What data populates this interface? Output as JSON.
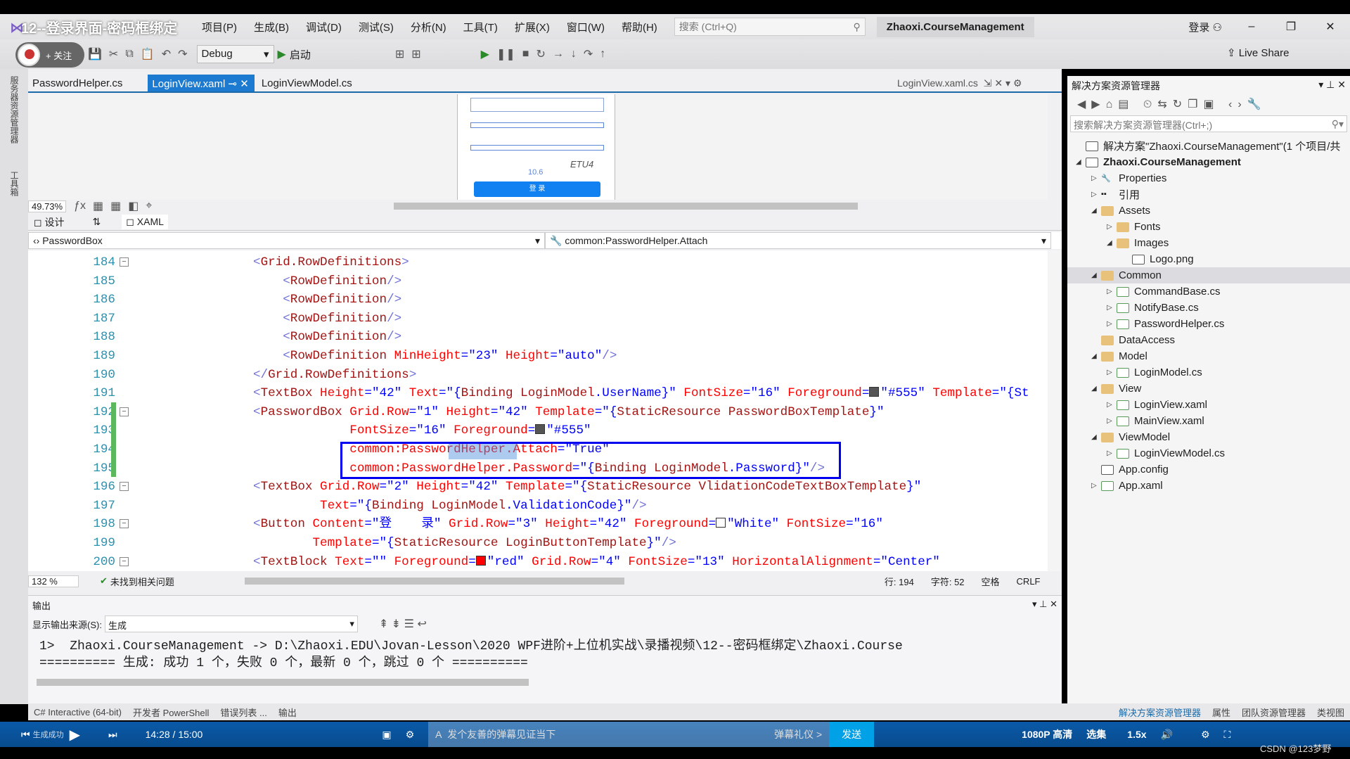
{
  "video_title": "12--登录界面-密码框绑定",
  "menu": [
    "项目(P)",
    "生成(B)",
    "调试(D)",
    "测试(S)",
    "分析(N)",
    "工具(T)",
    "扩展(X)",
    "窗口(W)",
    "帮助(H)"
  ],
  "search_placeholder": "搜索 (Ctrl+Q)",
  "solution_name": "Zhaoxi.CourseManagement",
  "login": "登录",
  "follow": "+ 关注",
  "config": "Debug",
  "start": "启动",
  "live_share": "Live Share",
  "left_strip": [
    "服务器资源管理器",
    "工具箱"
  ],
  "tabs": [
    {
      "label": "PasswordHelper.cs",
      "active": false
    },
    {
      "label": "LoginView.xaml",
      "active": true
    },
    {
      "label": "LoginViewModel.cs",
      "active": false
    }
  ],
  "tab_right": "LoginView.xaml.cs",
  "designer": {
    "zoom": "49.73%",
    "etu": "ETU4",
    "dim": "10.6",
    "button": "登 录",
    "design_tab": "设计",
    "xaml_tab": "XAML"
  },
  "nav": {
    "element": "PasswordBox",
    "member": "common:PasswordHelper.Attach"
  },
  "code_lines": [
    {
      "n": "184",
      "fold": true,
      "segs": [
        [
          "brk",
          "<"
        ],
        [
          "tagc",
          "Grid.RowDefinitions"
        ],
        [
          "brk",
          ">"
        ]
      ]
    },
    {
      "n": "185",
      "segs": [
        [
          "plain",
          "    "
        ],
        [
          "brk",
          "<"
        ],
        [
          "tagc",
          "RowDefinition"
        ],
        [
          "brk",
          "/>"
        ]
      ]
    },
    {
      "n": "186",
      "segs": [
        [
          "plain",
          "    "
        ],
        [
          "brk",
          "<"
        ],
        [
          "tagc",
          "RowDefinition"
        ],
        [
          "brk",
          "/>"
        ]
      ]
    },
    {
      "n": "187",
      "segs": [
        [
          "plain",
          "    "
        ],
        [
          "brk",
          "<"
        ],
        [
          "tagc",
          "RowDefinition"
        ],
        [
          "brk",
          "/>"
        ]
      ]
    },
    {
      "n": "188",
      "segs": [
        [
          "plain",
          "    "
        ],
        [
          "brk",
          "<"
        ],
        [
          "tagc",
          "RowDefinition"
        ],
        [
          "brk",
          "/>"
        ]
      ]
    },
    {
      "n": "189",
      "segs": [
        [
          "plain",
          "    "
        ],
        [
          "brk",
          "<"
        ],
        [
          "tagc",
          "RowDefinition "
        ],
        [
          "attr",
          "MinHeight"
        ],
        [
          "val",
          "=\"23\" "
        ],
        [
          "attr",
          "Height"
        ],
        [
          "val",
          "=\"auto\""
        ],
        [
          "brk",
          "/>"
        ]
      ]
    },
    {
      "n": "190",
      "segs": [
        [
          "brk",
          "</"
        ],
        [
          "tagc",
          "Grid.RowDefinitions"
        ],
        [
          "brk",
          ">"
        ]
      ]
    },
    {
      "n": "191",
      "segs": [
        [
          "brk",
          "<"
        ],
        [
          "tagc",
          "TextBox "
        ],
        [
          "attr",
          "Height"
        ],
        [
          "val",
          "=\"42\" "
        ],
        [
          "attr",
          "Text"
        ],
        [
          "val",
          "=\"{"
        ],
        [
          "tagc",
          "Binding LoginModel"
        ],
        [
          "val",
          ".UserName}\" "
        ],
        [
          "attr",
          "FontSize"
        ],
        [
          "val",
          "=\"16\" "
        ],
        [
          "attr",
          "Foreground"
        ],
        [
          "val",
          "="
        ],
        [
          "swatch",
          "#555555"
        ],
        [
          "val",
          "\"#555\" "
        ],
        [
          "attr",
          "Template"
        ],
        [
          "val",
          "=\"{St"
        ]
      ]
    },
    {
      "n": "192",
      "fold": true,
      "segs": [
        [
          "brk",
          "<"
        ],
        [
          "tagc",
          "PasswordBox "
        ],
        [
          "attr",
          "Grid.Row"
        ],
        [
          "val",
          "=\"1\" "
        ],
        [
          "attr",
          "Height"
        ],
        [
          "val",
          "=\"42\" "
        ],
        [
          "attr",
          "Template"
        ],
        [
          "val",
          "=\"{"
        ],
        [
          "tagc",
          "StaticResource PasswordBoxTemplate"
        ],
        [
          "val",
          "}\""
        ]
      ]
    },
    {
      "n": "193",
      "segs": [
        [
          "plain",
          "             "
        ],
        [
          "attr",
          "FontSize"
        ],
        [
          "val",
          "=\"16\" "
        ],
        [
          "attr",
          "Foreground"
        ],
        [
          "val",
          "="
        ],
        [
          "swatch",
          "#555555"
        ],
        [
          "val",
          "\"#555\""
        ]
      ]
    },
    {
      "n": "194",
      "segs": [
        [
          "plain",
          "             "
        ],
        [
          "attr",
          "common:PasswordHelper.Attach"
        ],
        [
          "val",
          "=\"True\""
        ]
      ]
    },
    {
      "n": "195",
      "segs": [
        [
          "plain",
          "             "
        ],
        [
          "attr",
          "common:PasswordHelper.Password"
        ],
        [
          "val",
          "=\"{"
        ],
        [
          "tagc",
          "Binding LoginModel"
        ],
        [
          "val",
          ".Password}\""
        ],
        [
          "brk",
          "/>"
        ]
      ]
    },
    {
      "n": "196",
      "fold": true,
      "segs": [
        [
          "brk",
          "<"
        ],
        [
          "tagc",
          "TextBox "
        ],
        [
          "attr",
          "Grid.Row"
        ],
        [
          "val",
          "=\"2\" "
        ],
        [
          "attr",
          "Height"
        ],
        [
          "val",
          "=\"42\" "
        ],
        [
          "attr",
          "Template"
        ],
        [
          "val",
          "=\"{"
        ],
        [
          "tagc",
          "StaticResource VlidationCodeTextBoxTemplate"
        ],
        [
          "val",
          "}\""
        ]
      ]
    },
    {
      "n": "197",
      "segs": [
        [
          "plain",
          "         "
        ],
        [
          "attr",
          "Text"
        ],
        [
          "val",
          "=\"{"
        ],
        [
          "tagc",
          "Binding LoginModel"
        ],
        [
          "val",
          ".ValidationCode}\""
        ],
        [
          "brk",
          "/>"
        ]
      ]
    },
    {
      "n": "198",
      "fold": true,
      "segs": [
        [
          "brk",
          "<"
        ],
        [
          "tagc",
          "Button "
        ],
        [
          "attr",
          "Content"
        ],
        [
          "val",
          "=\"登    录\" "
        ],
        [
          "attr",
          "Grid.Row"
        ],
        [
          "val",
          "=\"3\" "
        ],
        [
          "attr",
          "Height"
        ],
        [
          "val",
          "=\"42\" "
        ],
        [
          "attr",
          "Foreground"
        ],
        [
          "val",
          "="
        ],
        [
          "swatch",
          "#ffffff"
        ],
        [
          "val",
          "\"White\" "
        ],
        [
          "attr",
          "FontSize"
        ],
        [
          "val",
          "=\"16\""
        ]
      ]
    },
    {
      "n": "199",
      "segs": [
        [
          "plain",
          "        "
        ],
        [
          "attr",
          "Template"
        ],
        [
          "val",
          "=\"{"
        ],
        [
          "tagc",
          "StaticResource LoginButtonTemplate"
        ],
        [
          "val",
          "}\""
        ],
        [
          "brk",
          "/>"
        ]
      ]
    },
    {
      "n": "200",
      "fold": true,
      "segs": [
        [
          "brk",
          "<"
        ],
        [
          "tagc",
          "TextBlock "
        ],
        [
          "attr",
          "Text"
        ],
        [
          "val",
          "=\"\" "
        ],
        [
          "attr",
          "Foreground"
        ],
        [
          "val",
          "="
        ],
        [
          "swatch",
          "#ff0000"
        ],
        [
          "val",
          "\"red\" "
        ],
        [
          "attr",
          "Grid.Row"
        ],
        [
          "val",
          "=\"4\" "
        ],
        [
          "attr",
          "FontSize"
        ],
        [
          "val",
          "=\"13\" "
        ],
        [
          "attr",
          "HorizontalAlignment"
        ],
        [
          "val",
          "=\"Center\""
        ]
      ]
    }
  ],
  "code_status": {
    "zoom": "132 %",
    "issues": "未找到相关问题",
    "line": "行: 194",
    "char": "字符: 52",
    "space": "空格",
    "eol": "CRLF"
  },
  "output": {
    "title": "输出",
    "source_label": "显示输出来源(S):",
    "source": "生成",
    "lines": [
      "1>  Zhaoxi.CourseManagement -> D:\\Zhaoxi.EDU\\Jovan-Lesson\\2020 WPF进阶+上位机实战\\录播视频\\12--密码框绑定\\Zhaoxi.Course",
      "========== 生成: 成功 1 个，失败 0 个，最新 0 个，跳过 0 个 =========="
    ]
  },
  "bottom_tabs": [
    "C# Interactive (64-bit)",
    "开发者 PowerShell",
    "错误列表 ...",
    "输出"
  ],
  "bottom_tabs_right": [
    "解决方案资源管理器",
    "属性",
    "团队资源管理器",
    "类视图"
  ],
  "solution_explorer": {
    "title": "解决方案资源管理器",
    "search": "搜索解决方案资源管理器(Ctrl+;)",
    "items": [
      {
        "label": "解决方案\"Zhaoxi.CourseManagement\"(1 个项目/共",
        "level": 0,
        "arrow": "",
        "icon": "solution"
      },
      {
        "label": "Zhaoxi.CourseManagement",
        "level": 0,
        "arrow": "open",
        "icon": "project",
        "bold": true
      },
      {
        "label": "Properties",
        "level": 1,
        "arrow": "closed",
        "icon": "wrench"
      },
      {
        "label": "引用",
        "level": 1,
        "arrow": "closed",
        "icon": "references"
      },
      {
        "label": "Assets",
        "level": 1,
        "arrow": "open",
        "icon": "folder"
      },
      {
        "label": "Fonts",
        "level": 2,
        "arrow": "closed",
        "icon": "folder"
      },
      {
        "label": "Images",
        "level": 2,
        "arrow": "open",
        "icon": "folder"
      },
      {
        "label": "Logo.png",
        "level": 3,
        "arrow": "",
        "icon": "image"
      },
      {
        "label": "Common",
        "level": 1,
        "arrow": "open",
        "icon": "folder",
        "selected": true
      },
      {
        "label": "CommandBase.cs",
        "level": 2,
        "arrow": "closed",
        "icon": "cs"
      },
      {
        "label": "NotifyBase.cs",
        "level": 2,
        "arrow": "closed",
        "icon": "cs"
      },
      {
        "label": "PasswordHelper.cs",
        "level": 2,
        "arrow": "closed",
        "icon": "cs"
      },
      {
        "label": "DataAccess",
        "level": 1,
        "arrow": "",
        "icon": "folder"
      },
      {
        "label": "Model",
        "level": 1,
        "arrow": "open",
        "icon": "folder"
      },
      {
        "label": "LoginModel.cs",
        "level": 2,
        "arrow": "closed",
        "icon": "cs"
      },
      {
        "label": "View",
        "level": 1,
        "arrow": "open",
        "icon": "folder"
      },
      {
        "label": "LoginView.xaml",
        "level": 2,
        "arrow": "closed",
        "icon": "xaml"
      },
      {
        "label": "MainView.xaml",
        "level": 2,
        "arrow": "closed",
        "icon": "xaml"
      },
      {
        "label": "ViewModel",
        "level": 1,
        "arrow": "open",
        "icon": "folder"
      },
      {
        "label": "LoginViewModel.cs",
        "level": 2,
        "arrow": "closed",
        "icon": "cs"
      },
      {
        "label": "App.config",
        "level": 1,
        "arrow": "",
        "icon": "config"
      },
      {
        "label": "App.xaml",
        "level": 1,
        "arrow": "closed",
        "icon": "xaml"
      }
    ]
  },
  "player": {
    "status": "生成成功",
    "time": "14:28 / 15:00",
    "danmu_placeholder": "发个友善的弹幕见证当下",
    "etiquette": "弹幕礼仪 >",
    "send": "发送",
    "quality": "1080P 高清",
    "episodes": "选集",
    "speed": "1.5x"
  },
  "watermark": "CSDN @123梦野"
}
